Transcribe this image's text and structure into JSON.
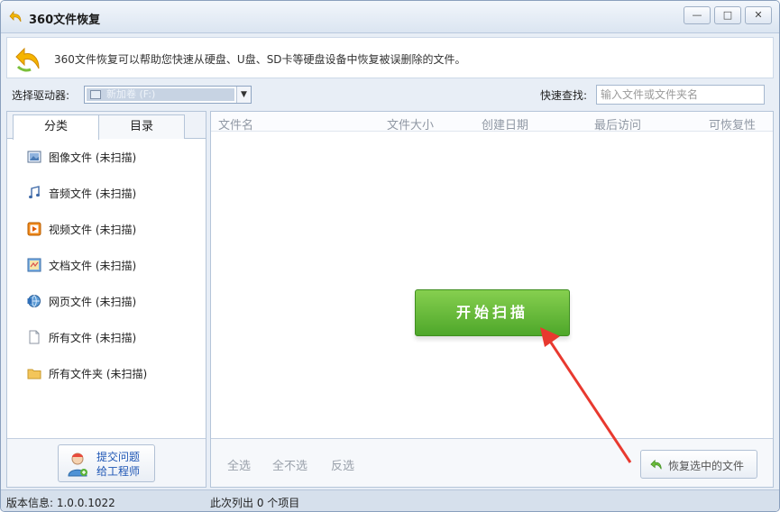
{
  "window": {
    "title": "360文件恢复",
    "controls": [
      "—",
      "□",
      "✕"
    ]
  },
  "info": {
    "text": "360文件恢复可以帮助您快速从硬盘、U盘、SD卡等硬盘设备中恢复被误删除的文件。"
  },
  "drive": {
    "label": "选择驱动器:",
    "selected": "新加卷 (F:)"
  },
  "search": {
    "label": "快速查找:",
    "placeholder": "输入文件或文件夹名"
  },
  "tabs": [
    {
      "label": "分类"
    },
    {
      "label": "目录"
    }
  ],
  "categories": [
    {
      "label": "图像文件 (未扫描)",
      "icon": "image-icon"
    },
    {
      "label": "音频文件 (未扫描)",
      "icon": "music-note-icon"
    },
    {
      "label": "视频文件 (未扫描)",
      "icon": "video-icon"
    },
    {
      "label": "文档文件 (未扫描)",
      "icon": "document-icon"
    },
    {
      "label": "网页文件 (未扫描)",
      "icon": "webpage-icon"
    },
    {
      "label": "所有文件 (未扫描)",
      "icon": "file-icon"
    },
    {
      "label": "所有文件夹 (未扫描)",
      "icon": "folder-icon"
    }
  ],
  "engineer": {
    "line1": "提交问题",
    "line2": "给工程师"
  },
  "columns": [
    "文件名",
    "文件大小",
    "创建日期",
    "最后访问",
    "可恢复性"
  ],
  "scan_button": "开始扫描",
  "selection": {
    "select_all": "全选",
    "select_none": "全不选",
    "invert": "反选"
  },
  "restore_button": "恢复选中的文件",
  "status": {
    "version": "版本信息: 1.0.0.1022",
    "listed": "此次列出 0 个项目"
  },
  "colors": {
    "scan_green": "#4ea72a",
    "annotation_arrow": "#e8392f"
  }
}
